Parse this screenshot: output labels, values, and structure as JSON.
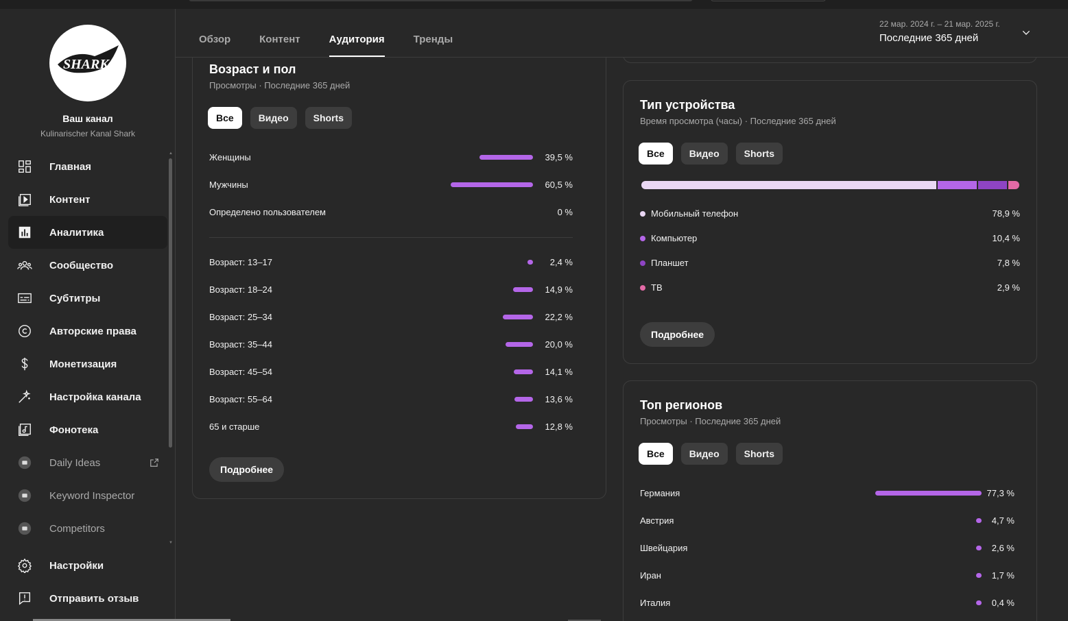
{
  "channel": {
    "logo_text": "SHARK",
    "title": "Ваш канал",
    "name": "Kulinarischer Kanal Shark"
  },
  "nav": {
    "items": [
      {
        "label": "Главная",
        "icon": "dashboard-icon"
      },
      {
        "label": "Контент",
        "icon": "content-icon"
      },
      {
        "label": "Аналитика",
        "icon": "analytics-icon",
        "active": true
      },
      {
        "label": "Сообщество",
        "icon": "community-icon"
      },
      {
        "label": "Субтитры",
        "icon": "subtitles-icon"
      },
      {
        "label": "Авторские права",
        "icon": "copyright-icon"
      },
      {
        "label": "Монетизация",
        "icon": "dollar-icon"
      },
      {
        "label": "Настройка канала",
        "icon": "magic-wand-icon"
      },
      {
        "label": "Фонотека",
        "icon": "audio-library-icon"
      },
      {
        "label": "Daily Ideas",
        "icon": "vidiq-icon"
      },
      {
        "label": "Keyword Inspector",
        "icon": "vidiq-icon"
      },
      {
        "label": "Competitors",
        "icon": "vidiq-icon"
      }
    ],
    "bottom": [
      {
        "label": "Настройки",
        "icon": "settings-icon"
      },
      {
        "label": "Отправить отзыв",
        "icon": "feedback-icon"
      }
    ]
  },
  "header": {
    "tabs": [
      "Обзор",
      "Контент",
      "Аудитория",
      "Тренды"
    ],
    "active_tab": "Аудитория",
    "date_range": "22 мар. 2024 г. – 21 мар. 2025 г.",
    "period": "Последние 365 дней"
  },
  "filters": [
    "Все",
    "Видео",
    "Shorts"
  ],
  "more_label": "Подробнее",
  "accent_color": "#b466e8",
  "age_gender": {
    "title": "Возраст и пол",
    "subtitle": "Просмотры · Последние 365 дней",
    "gender": [
      {
        "label": "Женщины",
        "value": 39.5,
        "display": "39,5 %"
      },
      {
        "label": "Мужчины",
        "value": 60.5,
        "display": "60,5 %"
      },
      {
        "label": "Определено пользователем",
        "value": 0,
        "display": "0 %"
      }
    ],
    "age": [
      {
        "label": "Возраст: 13–17",
        "value": 2.4,
        "display": "2,4 %"
      },
      {
        "label": "Возраст: 18–24",
        "value": 14.9,
        "display": "14,9 %"
      },
      {
        "label": "Возраст: 25–34",
        "value": 22.2,
        "display": "22,2 %"
      },
      {
        "label": "Возраст: 35–44",
        "value": 20.0,
        "display": "20,0 %"
      },
      {
        "label": "Возраст: 45–54",
        "value": 14.1,
        "display": "14,1 %"
      },
      {
        "label": "Возраст: 55–64",
        "value": 13.6,
        "display": "13,6 %"
      },
      {
        "label": "65 и старше",
        "value": 12.8,
        "display": "12,8 %"
      }
    ]
  },
  "devices": {
    "title": "Тип устройства",
    "subtitle": "Время просмотра (часы) · Последние 365 дней",
    "items": [
      {
        "label": "Мобильный телефон",
        "value": 78.9,
        "display": "78,9 %",
        "color": "#ead7f4"
      },
      {
        "label": "Компьютер",
        "value": 10.4,
        "display": "10,4 %",
        "color": "#b466e8"
      },
      {
        "label": "Планшет",
        "value": 7.8,
        "display": "7,8 %",
        "color": "#8e44c4"
      },
      {
        "label": "ТВ",
        "value": 2.9,
        "display": "2,9 %",
        "color": "#e36aa6"
      }
    ]
  },
  "regions": {
    "title": "Топ регионов",
    "subtitle": "Просмотры · Последние 365 дней",
    "items": [
      {
        "label": "Германия",
        "value": 77.3,
        "display": "77,3 %"
      },
      {
        "label": "Австрия",
        "value": 4.7,
        "display": "4,7 %"
      },
      {
        "label": "Швейцария",
        "value": 2.6,
        "display": "2,6 %"
      },
      {
        "label": "Иран",
        "value": 1.7,
        "display": "1,7 %"
      },
      {
        "label": "Италия",
        "value": 0.4,
        "display": "0,4 %"
      }
    ]
  }
}
